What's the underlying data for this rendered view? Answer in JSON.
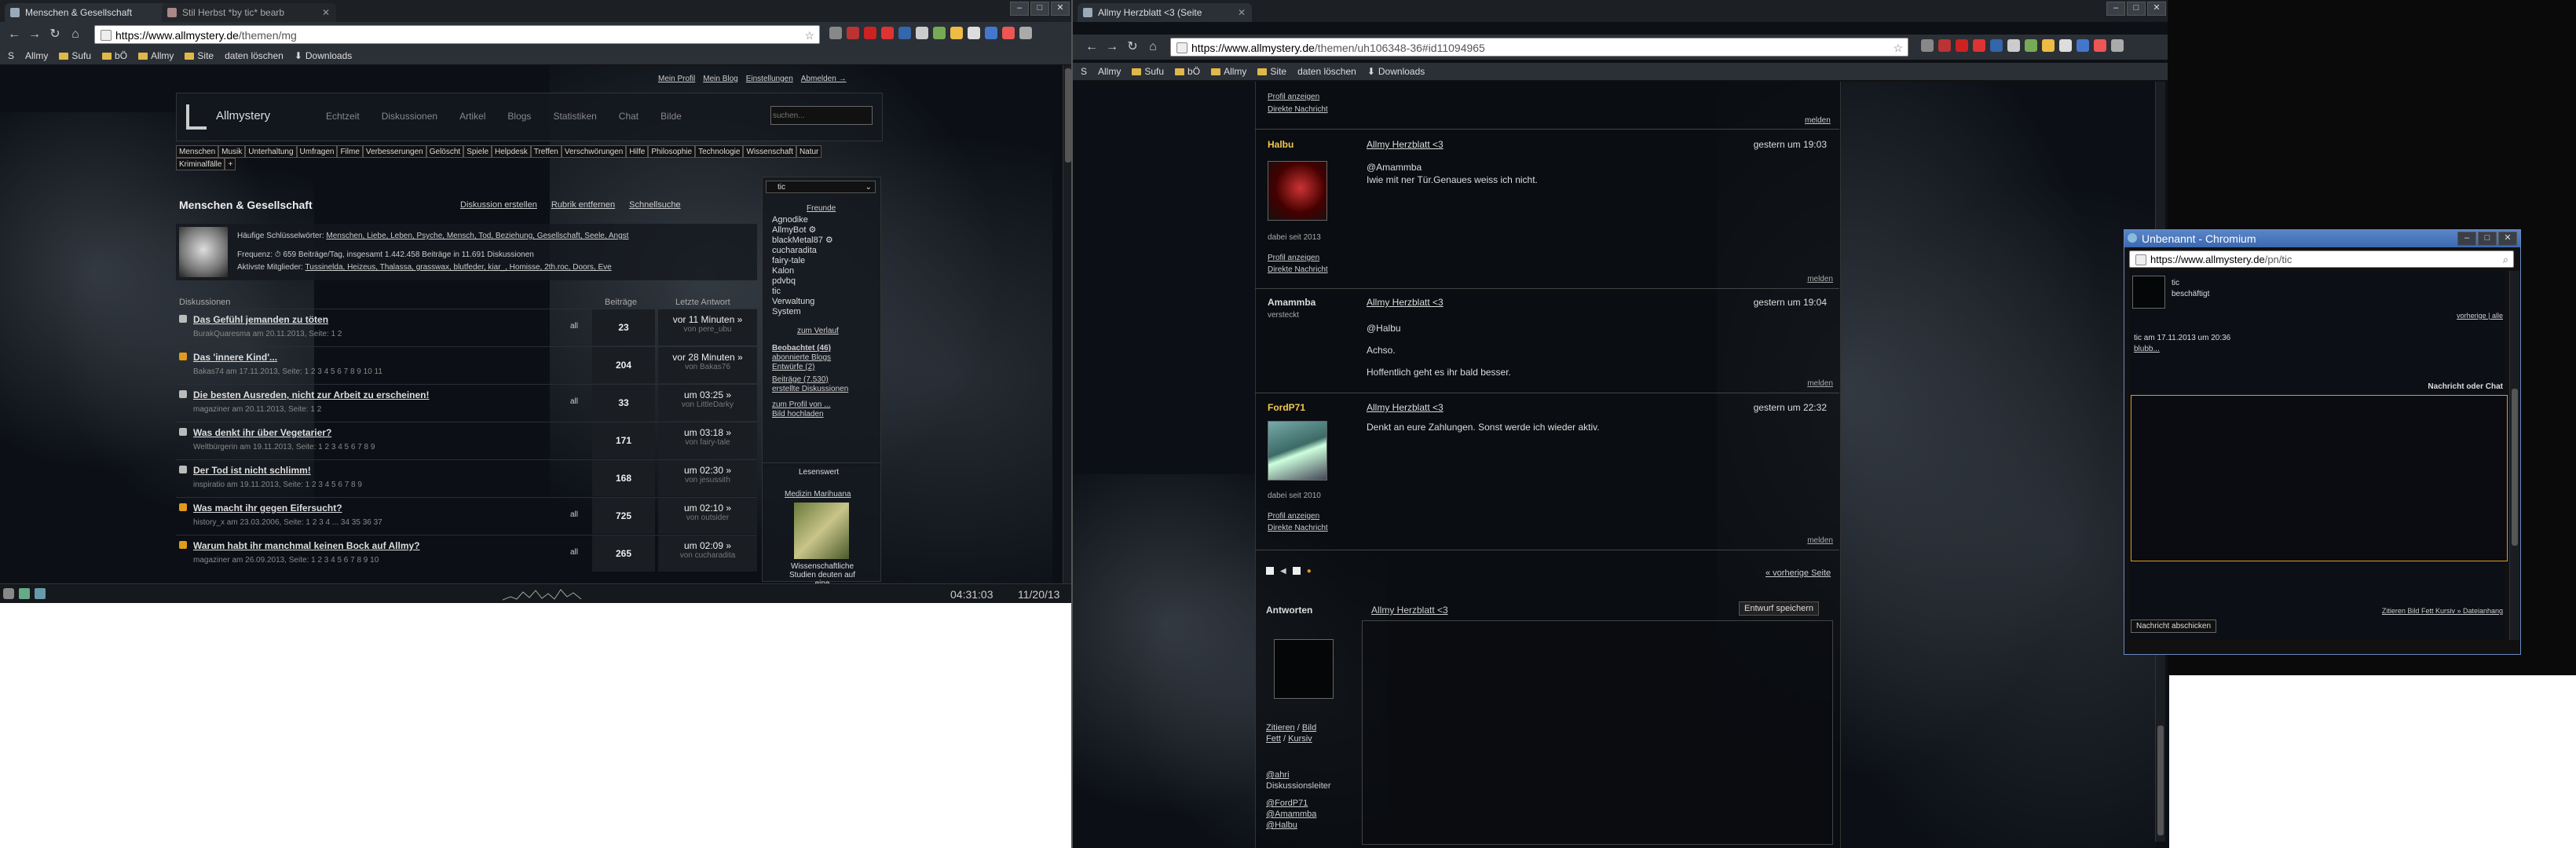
{
  "colors": {
    "accent_orange": "#e39a1a",
    "name_yellow": "#f2c94c",
    "tab_active": "#2b2f36",
    "page_bg": "#0c1016"
  },
  "left": {
    "tabs": [
      {
        "label": "Menschen & Gesellschaft"
      },
      {
        "label": "Stil Herbst *by tic* bearb"
      }
    ],
    "url": {
      "host": "https://www.allmystery.de",
      "path": "/themen/mg"
    },
    "bookmarks": [
      "S",
      "Allmy",
      "Sufu",
      "bÖ",
      "Allmy",
      "Site",
      "daten löschen",
      "Downloads"
    ],
    "toplinks": [
      "Mein Profil",
      "Mein Blog",
      "Einstellungen",
      "Abmelden →"
    ],
    "logo": "Allmystery",
    "nav": [
      "Echtzeit",
      "Diskussionen",
      "Artikel",
      "Blogs",
      "Statistiken",
      "Chat",
      "Bilde"
    ],
    "search_placeholder": "suchen...",
    "categories": [
      "Menschen",
      "Musik",
      "Unterhaltung",
      "Umfragen",
      "Filme",
      "Verbesserungen",
      "Gelöscht",
      "Spiele",
      "Helpdesk",
      "Treffen",
      "Verschwörungen",
      "Hilfe",
      "Philosophie",
      "Technologie",
      "Wissenschaft",
      "Natur",
      "Kriminalfälle",
      "+"
    ],
    "section_title": "Menschen & Gesellschaft",
    "section_actions": [
      "Diskussion erstellen",
      "Rubrik entfernen",
      "Schnellsuche"
    ],
    "keywords_label": "Häufige Schlüsselwörter:",
    "keywords": "Menschen, Liebe, Leben, Psyche, Mensch, Tod, Beziehung, Gesellschaft, Seele, Angst",
    "freq": "Frequenz: ⏱ 659 Beiträge/Tag, insgesamt 1.442.458 Beiträge in 11.691 Diskussionen",
    "active_label": "Aktivste Mitglieder:",
    "active": "Tussinelda, Heizeus, Thalassa, grasswax, blutfeder, kiar_, Homisse, 2th.roc, Doors, Eve",
    "col_headers": [
      "Diskussionen",
      "Beiträge",
      "Letzte Antwort"
    ],
    "threads": [
      {
        "title": "Das Gefühl jemanden zu töten",
        "meta": "BurakQuaresma am 20.11.2013, Seite: 1 2",
        "count": "23",
        "last": "vor 11 Minuten »",
        "by": "von pere_ubu",
        "all": "all",
        "color": "#bbb"
      },
      {
        "title": "Das 'innere Kind'...",
        "meta": "Bakas74 am 17.11.2013, Seite: 1 2 3 4 5 6 7 8 9 10 11",
        "count": "204",
        "last": "vor 28 Minuten »",
        "by": "von Bakas76",
        "all": "",
        "color": "#e39a1a"
      },
      {
        "title": "Die besten Ausreden, nicht zur Arbeit zu erscheinen!",
        "meta": "magaziner am 20.11.2013, Seite: 1 2",
        "count": "33",
        "last": "um 03:25 »",
        "by": "von LittleDarky",
        "all": "all",
        "color": "#bbb"
      },
      {
        "title": "Was denkt ihr über Vegetarier?",
        "meta": "Weltbürgerin am 19.11.2013, Seite: 1 2 3 4 5 6 7 8 9",
        "count": "171",
        "last": "um 03:18 »",
        "by": "von fairy-tale",
        "all": "",
        "color": "#bbb"
      },
      {
        "title": "Der Tod ist nicht schlimm!",
        "meta": "inspiratio am 19.11.2013, Seite: 1 2 3 4 5 6 7 8 9",
        "count": "168",
        "last": "um 02:30 »",
        "by": "von jesussith",
        "all": "",
        "color": "#bbb"
      },
      {
        "title": "Was macht ihr gegen Eifersucht?",
        "meta": "history_x am 23.03.2006, Seite: 1 2 3 4 ... 34 35 36 37",
        "count": "725",
        "last": "um 02:10 »",
        "by": "von outsider",
        "all": "all",
        "color": "#e39a1a"
      },
      {
        "title": "Warum habt ihr manchmal keinen Bock auf Allmy?",
        "meta": "magaziner am 26.09.2013, Seite: 1 2 3 4 5 6 7 8 9 10",
        "count": "265",
        "last": "um 02:09 »",
        "by": "von cucharadita",
        "all": "all",
        "color": "#e39a1a"
      }
    ],
    "user": "tic",
    "friends_title": "Freunde",
    "friends": [
      "Agnodike",
      "AllmyBot ⚙",
      "blackMetal87 ⚙",
      "cucharadita",
      "fairy-tale",
      "Kalon",
      "pdvbq",
      "tic",
      "Verwaltung",
      "System"
    ],
    "zum_verlauf": "zum Verlauf",
    "watch": [
      "Beobachtet (46)",
      "abonnierte Blogs",
      "Entwürfe (2)"
    ],
    "stats": [
      "Beiträge (7.530)",
      "erstellte Diskussionen"
    ],
    "profile": [
      "zum Profil von ...",
      "Bild hochladen"
    ],
    "lesenswert": "Lesenswert",
    "lesenswert_link": "Medizin Marihuana",
    "lesenswert_text": "Wissenschaftliche Studien deuten auf eine",
    "clock": "04:31:03",
    "date": "11/20/13"
  },
  "middle": {
    "tab": "Allmy Herzblatt <3 (Seite",
    "url": {
      "host": "https://www.allmystery.de",
      "path": "/themen/uh106348-36#id11094965"
    },
    "bookmarks": [
      "S",
      "Allmy",
      "Sufu",
      "bÖ",
      "Allmy",
      "Site",
      "daten löschen",
      "Downloads"
    ],
    "top_links": [
      "Profil anzeigen",
      "Direkte Nachricht"
    ],
    "melden": "melden",
    "posts": [
      {
        "name": "Halbu",
        "status": "",
        "title": "Allmy Herzblatt <3",
        "time": "gestern um 19:03",
        "body": [
          "@Amammba",
          "Iwie mit ner Tür.Genaues weiss ich nicht."
        ],
        "since": "dabei seit 2013",
        "links": [
          "Profil anzeigen",
          "Direkte Nachricht"
        ]
      },
      {
        "name": "Amammba",
        "status": "versteckt",
        "title": "Allmy Herzblatt <3",
        "time": "gestern um 19:04",
        "body": [
          "@Halbu",
          "Achso.",
          "Hoffentlich geht es ihr bald besser."
        ],
        "since": "",
        "links": []
      },
      {
        "name": "FordP71",
        "status": "",
        "title": "Allmy Herzblatt <3",
        "time": "gestern um 22:32",
        "body": [
          "Denkt an eure Zahlungen. Sonst werde ich wieder aktiv."
        ],
        "since": "dabei seit 2010",
        "links": [
          "Profil anzeigen",
          "Direkte Nachricht"
        ]
      }
    ],
    "prev_page": "« vorherige Seite",
    "reply_label": "Antworten",
    "reply_title": "Allmy Herzblatt <3",
    "draft_btn": "Entwurf speichern",
    "format_links": [
      "Zitieren",
      "Bild",
      "Fett",
      "Kursiv"
    ],
    "mentions": [
      "@ahri",
      "Diskussionsleiter",
      "@FordP71",
      "@Amammba",
      "@Halbu"
    ]
  },
  "popup": {
    "title": "Unbenannt - Chromium",
    "url": {
      "host": "https://www.allmystery.de",
      "path": "/pn/tic"
    },
    "user": "tic",
    "status": "beschäftigt",
    "nav": "vorherige | alle",
    "msg_meta": "tic am 17.11.2013 um 20:36",
    "msg_body": "blubb...",
    "nachricht_label": "Nachricht oder Chat",
    "format_links": "Zitieren Bild Fett Kursiv » Dateianhang",
    "send_btn": "Nachricht abschicken"
  }
}
